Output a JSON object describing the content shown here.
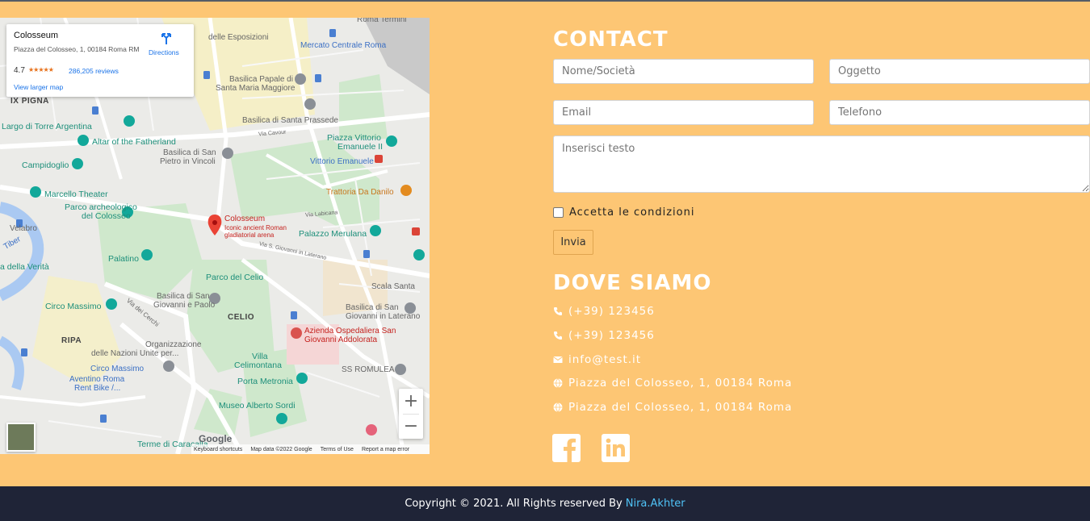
{
  "map": {
    "place_name": "Colosseum",
    "address": "Piazza del Colosseo, 1, 00184 Roma RM",
    "rating": "4.7",
    "stars": "★★★★★",
    "reviews": "286,205 reviews",
    "view_larger": "View larger map",
    "directions": "Directions",
    "zoom_in": "+",
    "zoom_out": "−",
    "google": "Google",
    "attribution": [
      "Keyboard shortcuts",
      "Map data ©2022 Google",
      "Terms of Use",
      "Report a map error"
    ],
    "labels": {
      "roma_termini": "Roma Termini",
      "palazzo_esposizioni": "delle Esposizioni",
      "mercato": "Mercato Centrale Roma",
      "basilica_maggiore_1": "Basilica Papale di",
      "basilica_maggiore_2": "Santa Maria Maggiore",
      "ix_pigna": "IX PIGNA",
      "largo_argentina": "Largo di Torre Argentina",
      "santa_prassede": "Basilica di Santa Prassede",
      "altar": "Altar of the Fatherland",
      "piazza_vittorio_1": "Piazza Vittorio",
      "piazza_vittorio_2": "Emanuele II",
      "basilica_pietro_1": "Basilica di San",
      "basilica_pietro_2": "Pietro in Vincoli",
      "campidoglio": "Campidoglio",
      "vittorio_emanuele": "Vittorio Emanuele",
      "marcello": "Marcello Theater",
      "trattoria": "Trattoria Da Danilo",
      "parco_archeo_1": "Parco archeologico",
      "parco_archeo_2": "del Colosseo",
      "colosseum": "Colosseum",
      "colosseum_desc_1": "Iconic ancient Roman",
      "colosseum_desc_2": "gladiatorial arena",
      "velabro": "Velabro",
      "palazzo_merulana": "Palazzo Merulana",
      "tiber": "Tiber",
      "palatino": "Palatino",
      "verita": "a della Verità",
      "parco_celio": "Parco del Celio",
      "scala_santa": "Scala Santa",
      "basilica_giovanni_1": "Basilica di San",
      "basilica_giovanni_2": "Giovanni e Paolo",
      "circo_massimo": "Circo Massimo",
      "celio": "CELIO",
      "basilica_laterano_1": "Basilica di San",
      "basilica_laterano_2": "Giovanni in Laterano",
      "azienda_1": "Azienda Ospedaliera San",
      "azienda_2": "Giovanni Addolorata",
      "ripa": "RIPA",
      "organizzazione_1": "Organizzazione",
      "organizzazione_2": "delle Nazioni Unite per...",
      "villa_1": "Villa",
      "villa_2": "Celimontana",
      "ss_romulea": "SS ROMULEA",
      "circo_massimo_station": "Circo Massimo",
      "aventino_1": "Aventino Roma",
      "aventino_2": "Rent Bike /...",
      "porta_metronia": "Porta Metronia",
      "museo_sordi": "Museo Alberto Sordi",
      "terme": "Terme di Caracalla",
      "via_cavour": "Via Cavour",
      "via_labicana": "Via Labicana",
      "via_cerchi": "Via dei Cerchi",
      "via_giovanni": "Via S. Giovanni in Laterano"
    }
  },
  "contact": {
    "title": "CONTACT",
    "name_placeholder": "Nome/Società",
    "subject_placeholder": "Oggetto",
    "email_placeholder": "Email",
    "phone_placeholder": "Telefono",
    "message_placeholder": "Inserisci testo",
    "accept_label": "Accetta le condizioni",
    "submit_label": "Invia"
  },
  "location": {
    "title": "DOVE SIAMO",
    "items": [
      {
        "icon": "phone-icon",
        "text": "(+39) 123456"
      },
      {
        "icon": "phone-icon",
        "text": "(+39) 123456"
      },
      {
        "icon": "envelope-icon",
        "text": "info@test.it"
      },
      {
        "icon": "globe-icon",
        "text": "Piazza del Colosseo, 1, 00184 Roma"
      },
      {
        "icon": "globe-icon",
        "text": "Piazza del Colosseo, 1, 00184 Roma"
      }
    ]
  },
  "footer": {
    "copyright": "Copyright © 2021. All Rights reserved By",
    "author": "Nira.Akhter"
  },
  "colors": {
    "page_bg": "#fdc674",
    "footer_bg": "#1f2437",
    "author_link": "#4fc3f7"
  }
}
